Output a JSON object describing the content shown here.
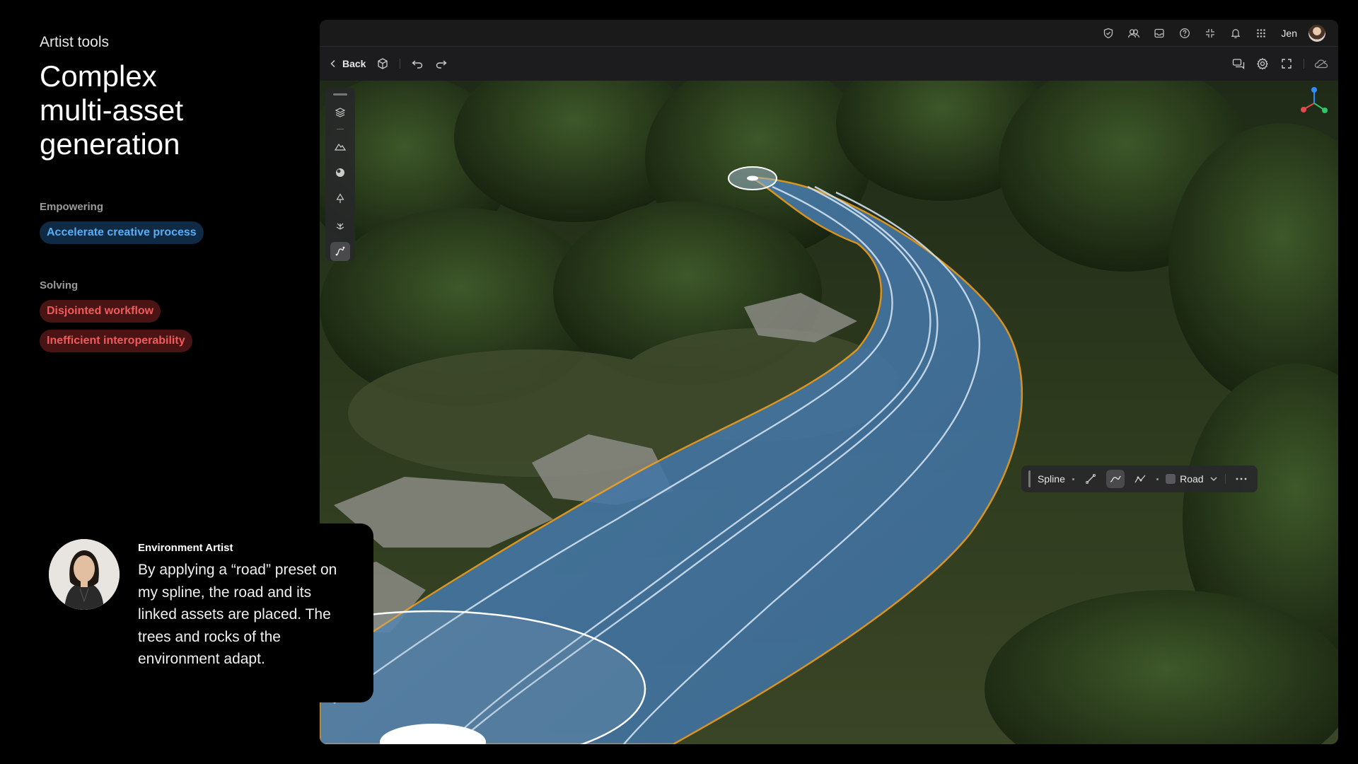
{
  "left_panel": {
    "eyebrow": "Artist tools",
    "headline_lines": [
      "Complex",
      "multi-asset",
      "generation"
    ],
    "empowering_label": "Empowering",
    "empowering_tags": [
      "Accelerate creative process"
    ],
    "solving_label": "Solving",
    "solving_tags": [
      "Disjointed workflow",
      "Inefficient interoperability"
    ]
  },
  "app": {
    "topbar": {
      "icons": [
        "shield-check-icon",
        "users-icon",
        "inbox-icon",
        "help-icon",
        "collapse-icon",
        "bell-icon",
        "apps-grid-icon"
      ],
      "user_name": "Jen"
    },
    "toolbar": {
      "back_label": "Back",
      "left_icons": [
        "cube-icon",
        "undo-icon",
        "redo-icon"
      ],
      "right_icons": [
        "comments-icon",
        "settings-icon",
        "fullscreen-icon",
        "cloud-icon"
      ]
    },
    "tool_rail": {
      "items": [
        "layers-icon",
        "terrain-icon",
        "material-icon",
        "tree-icon",
        "foliage-icon",
        "spline-icon"
      ],
      "active": "spline-icon"
    },
    "spline_bar": {
      "label": "Spline",
      "modes": [
        "linear-spline-icon",
        "curve-spline-icon",
        "points-spline-icon"
      ],
      "active_mode": "curve-spline-icon",
      "preset": "Road"
    },
    "gizmo_colors": {
      "y": "#2f8cff",
      "x": "#e5484d",
      "z": "#30c46b"
    }
  },
  "quote_card": {
    "role": "Environment Artist",
    "text": "By applying a “road” preset on my spline, the road and its linked assets are placed. The trees and rocks of the environment adapt."
  },
  "colors": {
    "empower_bg": "#0f2a44",
    "empower_fg": "#57aef5",
    "solve_bg": "#4a1414",
    "solve_fg": "#f05a5a",
    "spline_outline": "#f0a020",
    "road_overlay": "#4a8fd0"
  }
}
